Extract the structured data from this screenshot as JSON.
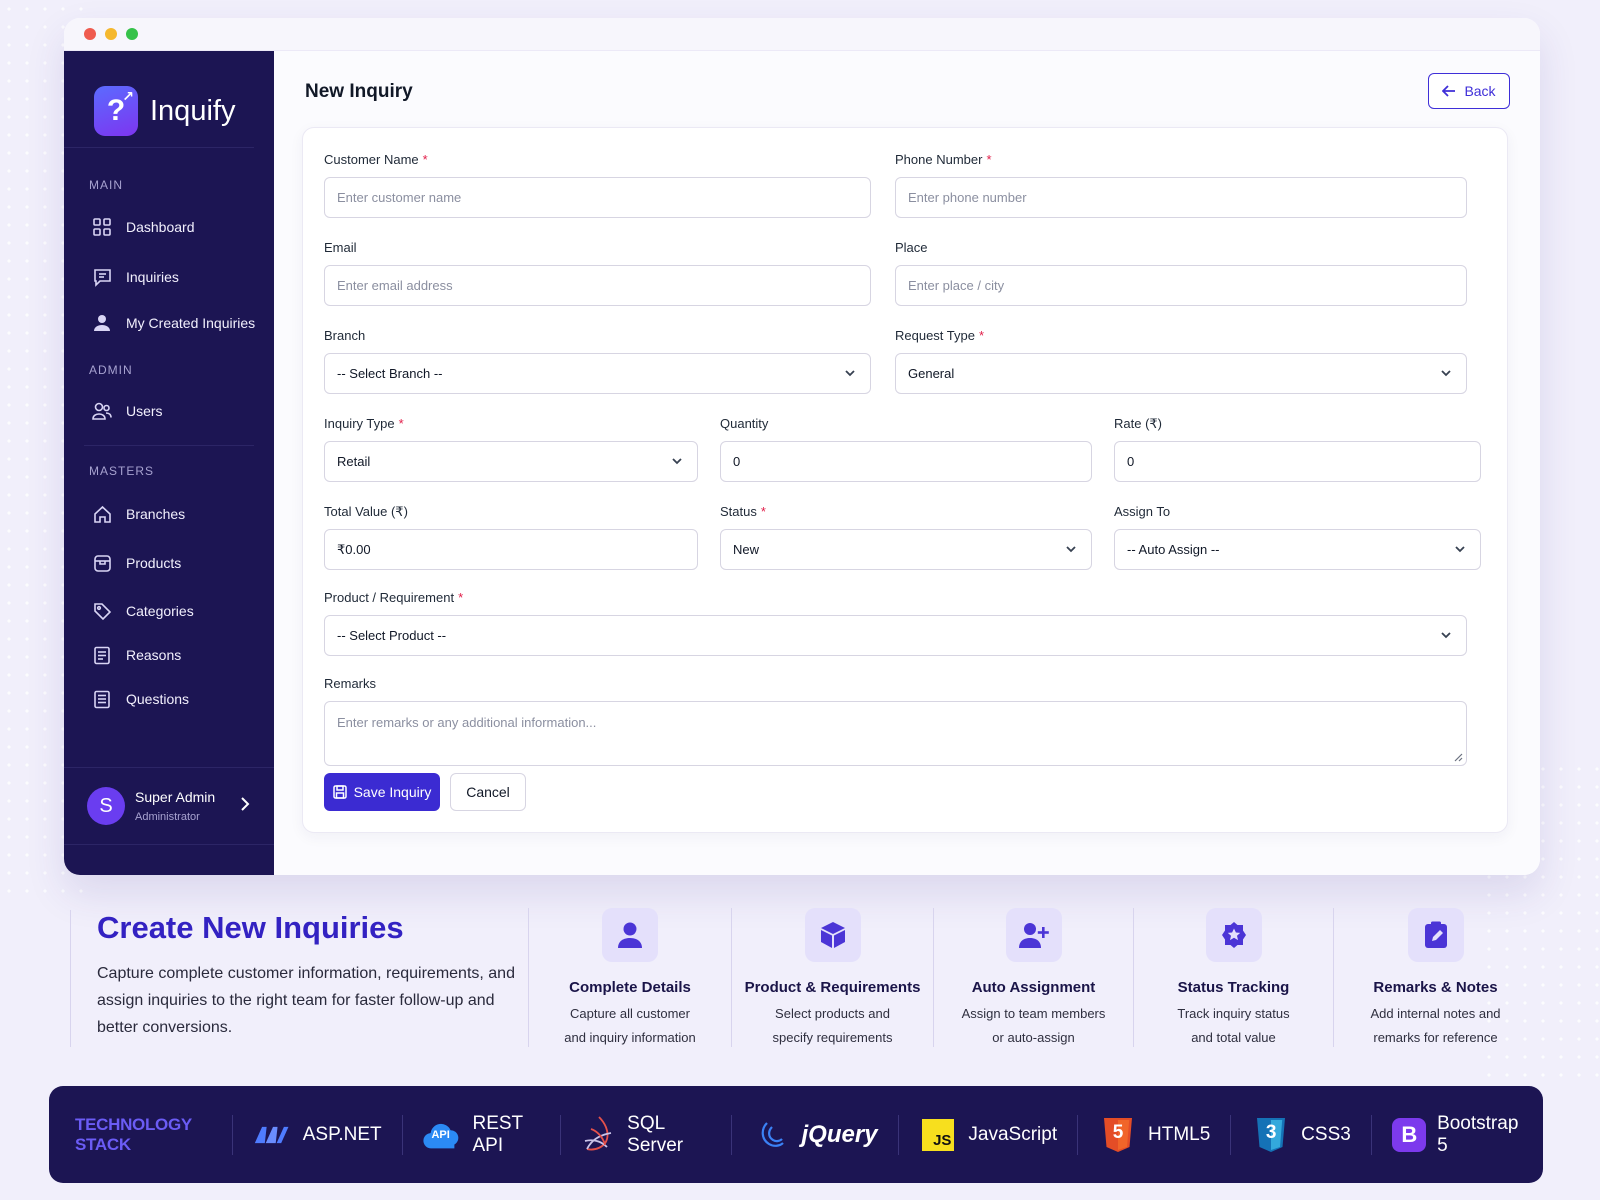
{
  "app": {
    "name": "Inquify"
  },
  "sidebar": {
    "sections": {
      "main": "MAIN",
      "admin": "ADMIN",
      "masters": "MASTERS"
    },
    "main_items": [
      {
        "label": "Dashboard",
        "icon": "grid-icon"
      },
      {
        "label": "Inquiries",
        "icon": "chat-icon"
      },
      {
        "label": "My Created Inquiries",
        "icon": "user-icon"
      }
    ],
    "admin_items": [
      {
        "label": "Users",
        "icon": "users-icon"
      }
    ],
    "master_items": [
      {
        "label": "Branches",
        "icon": "home-icon"
      },
      {
        "label": "Products",
        "icon": "box-icon"
      },
      {
        "label": "Categories",
        "icon": "tag-icon"
      },
      {
        "label": "Reasons",
        "icon": "document-icon"
      },
      {
        "label": "Questions",
        "icon": "list-icon"
      }
    ],
    "profile": {
      "initial": "S",
      "name": "Super Admin",
      "role": "Administrator"
    }
  },
  "header": {
    "title": "New Inquiry",
    "back_label": "Back"
  },
  "form": {
    "customer_name": {
      "label": "Customer Name",
      "placeholder": "Enter customer name"
    },
    "phone": {
      "label": "Phone Number",
      "placeholder": "Enter phone number"
    },
    "email": {
      "label": "Email",
      "placeholder": "Enter email address"
    },
    "place": {
      "label": "Place",
      "placeholder": "Enter place / city"
    },
    "branch": {
      "label": "Branch",
      "value": "-- Select Branch --"
    },
    "request_type": {
      "label": "Request Type",
      "value": "General"
    },
    "inquiry_type": {
      "label": "Inquiry Type",
      "value": "Retail"
    },
    "quantity": {
      "label": "Quantity",
      "value": "0"
    },
    "rate": {
      "label": "Rate (₹)",
      "value": "0"
    },
    "total_value": {
      "label": "Total Value (₹)",
      "value": "₹0.00"
    },
    "status": {
      "label": "Status",
      "value": "New"
    },
    "assign_to": {
      "label": "Assign To",
      "value": "-- Auto Assign --"
    },
    "product": {
      "label": "Product / Requirement",
      "value": "-- Select Product --"
    },
    "remarks": {
      "label": "Remarks",
      "placeholder": "Enter remarks or any additional information..."
    },
    "required_mark": "*",
    "save_label": "Save Inquiry",
    "cancel_label": "Cancel"
  },
  "hero": {
    "title": "Create New Inquiries",
    "text": "Capture complete customer information, requirements, and assign inquiries to the right team for faster follow-up and better conversions."
  },
  "features": [
    {
      "title": "Complete Details",
      "line1": "Capture all customer",
      "line2": "and inquiry information",
      "icon": "person-icon"
    },
    {
      "title": "Product & Requirements",
      "line1": "Select products and",
      "line2": "specify requirements",
      "icon": "cube-icon"
    },
    {
      "title": "Auto Assignment",
      "line1": "Assign to team members",
      "line2": "or auto-assign",
      "icon": "user-plus-icon"
    },
    {
      "title": "Status Tracking",
      "line1": "Track inquiry status",
      "line2": "and total value",
      "icon": "star-badge-icon"
    },
    {
      "title": "Remarks & Notes",
      "line1": "Add internal notes and",
      "line2": "remarks for reference",
      "icon": "clipboard-edit-icon"
    }
  ],
  "tech_stack": {
    "label": "TECHNOLOGY STACK",
    "items": [
      {
        "name": "ASP.NET",
        "icon": "aspnet-logo"
      },
      {
        "name": "REST API",
        "icon": "api-cloud-logo",
        "badge": "API"
      },
      {
        "name": "SQL Server",
        "icon": "sqlserver-logo"
      },
      {
        "name": "jQuery",
        "icon": "jquery-logo"
      },
      {
        "name": "JavaScript",
        "icon": "javascript-logo",
        "badge": "JS"
      },
      {
        "name": "HTML5",
        "icon": "html5-logo",
        "badge": "5"
      },
      {
        "name": "CSS3",
        "icon": "css3-logo",
        "badge": "3"
      },
      {
        "name": "Bootstrap 5",
        "icon": "bootstrap-logo",
        "badge": "B"
      }
    ]
  },
  "colors": {
    "sidebar_bg": "#1c1553",
    "primary": "#3b2bd2",
    "accent_title": "#3322c2",
    "required": "#e11d48"
  }
}
